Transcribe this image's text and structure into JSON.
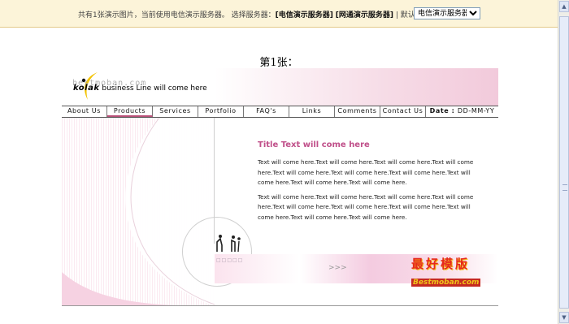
{
  "topbar": {
    "info": "共有1张演示图片，当前使用电信演示服务器。 选择服务器：",
    "server_telecom": "[电信演示服务器]",
    "server_netcom": "[网通演示服务器]",
    "default_label": "| 默认演示：",
    "select_value": "电信演示服务器"
  },
  "heading": "第1张：",
  "template": {
    "watermark": "bestmoban.com",
    "brand_name": "kolak",
    "brand_tagline": "business Line will come here",
    "nav": [
      "About Us",
      "Products",
      "Services",
      "Portfolio",
      "FAQ's",
      "Links",
      "Comments",
      "Contact Us"
    ],
    "active_nav": "Products",
    "date_label": "Date :",
    "date_value": "DD-MM-YY",
    "content_title": "Title Text will come here",
    "paragraph1": "Text will come here.Text will come here.Text will come here.Text will come here.Text will come here.Text will come here.Text will come here.Text will come here.Text will come here.Text will come here.",
    "paragraph2": "Text will come here.Text will come here.Text will come here.Text will come here.Text will come here.Text will come here.Text will come here.Text will come here.Text will come here.Text will come here.",
    "badge_cn": "最好模版",
    "badge_en": "Bestmoban.com",
    "accent_color": "#c0508a"
  }
}
